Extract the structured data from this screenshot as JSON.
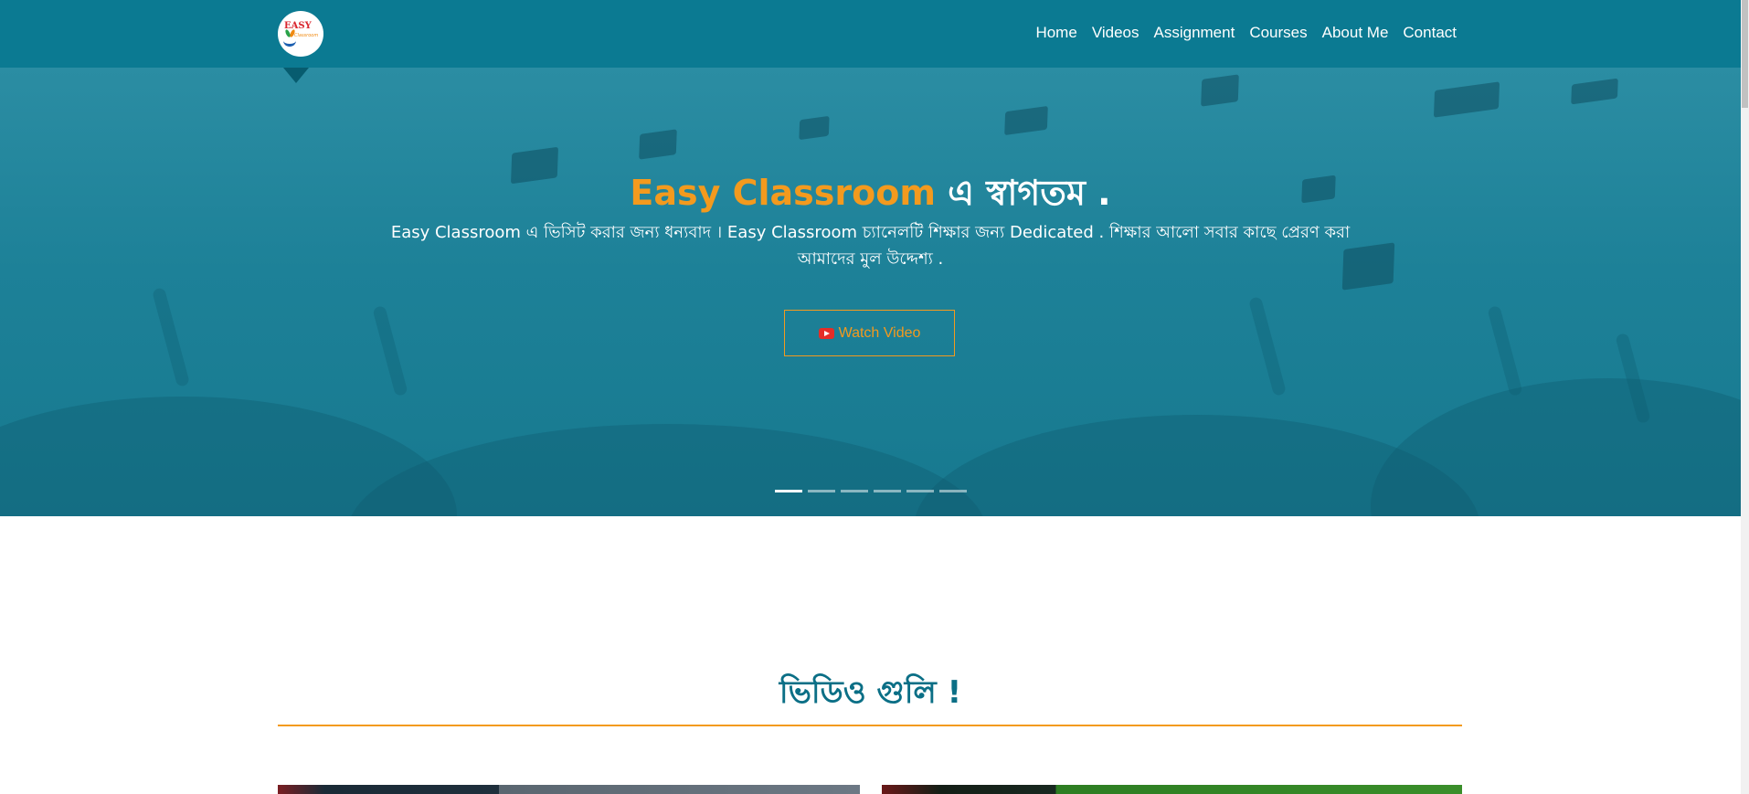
{
  "header": {
    "logo": {
      "word": "EASY",
      "sub": "Classroom"
    },
    "nav": [
      "Home",
      "Videos",
      "Assignment",
      "Courses",
      "About Me",
      "Contact"
    ]
  },
  "hero": {
    "title_brand": "Easy Classroom",
    "title_rest": " এ স্বাগতম .",
    "text": "Easy Classroom এ ভিসিট করার জন্য ধন্যবাদ । Easy Classroom চ্যানেলটি শিক্ষার জন্য Dedicated . শিক্ষার আলো সবার কাছে প্রেরণ করা আমাদের মুল উদ্দেশ্য .",
    "button_label": "Watch Video",
    "button_icon": "youtube-icon",
    "slides": 6,
    "active_slide": 1
  },
  "videos_section": {
    "title": "ভিডিও গুলি !"
  },
  "colors": {
    "primary": "#0b7a92",
    "accent": "#f39a1e",
    "heading": "#0b6f86"
  }
}
